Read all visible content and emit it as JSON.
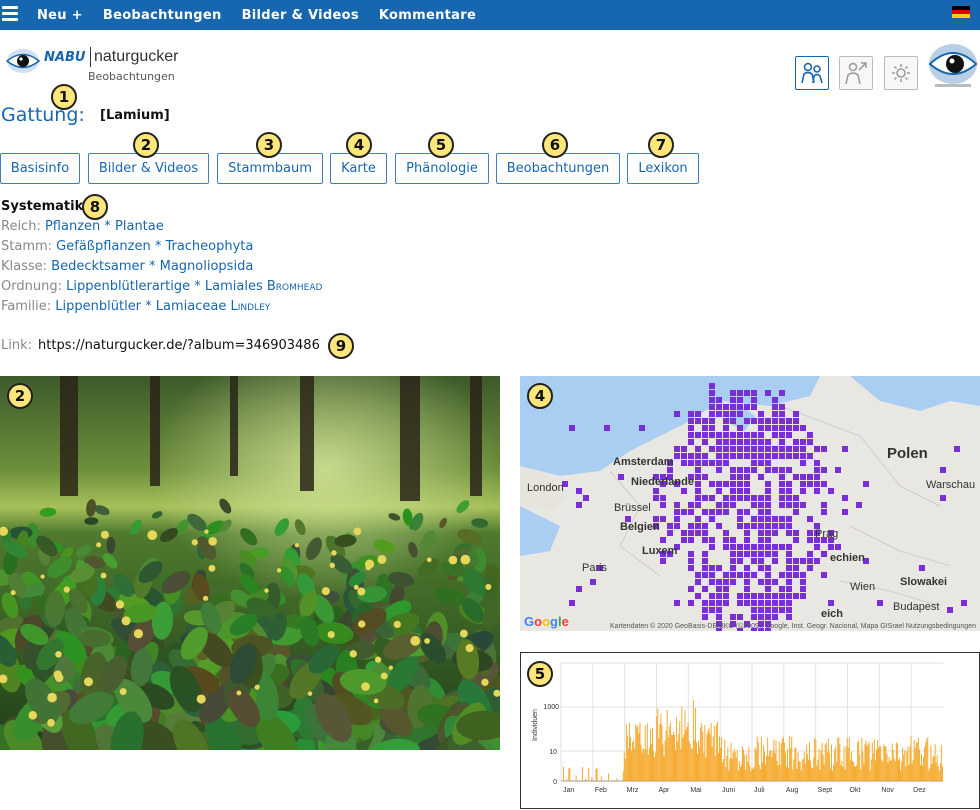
{
  "topbar": {
    "nav": [
      "Neu +",
      "Beobachtungen",
      "Bilder & Videos",
      "Kommentare"
    ]
  },
  "logo": {
    "brand": "NABU",
    "brand2": "naturgucker",
    "sub": "Beobachtungen"
  },
  "title": {
    "label": "Gattung:",
    "genus": "[Lamium]"
  },
  "tabs": [
    "Basisinfo",
    "Bilder & Videos",
    "Stammbaum",
    "Karte",
    "Phänologie",
    "Beobachtungen",
    "Lexikon"
  ],
  "systematik": {
    "heading": "Systematik",
    "rows": [
      {
        "label": "Reich:",
        "value": "Pflanzen * Plantae",
        "author": ""
      },
      {
        "label": "Stamm:",
        "value": "Gefäßpflanzen * Tracheophyta",
        "author": ""
      },
      {
        "label": "Klasse:",
        "value": "Bedecktsamer * Magnoliopsida",
        "author": ""
      },
      {
        "label": "Ordnung:",
        "value": "Lippenblütlerartige * Lamiales",
        "author": "Bromhead"
      },
      {
        "label": "Familie:",
        "value": "Lippenblütler * Lamiaceae",
        "author": "Lindley"
      }
    ]
  },
  "link": {
    "label": "Link:",
    "url": "https://naturgucker.de/?album=346903486"
  },
  "map": {
    "labels": [
      "Amsterdam",
      "Niederlande",
      "London",
      "Brüssel",
      "Belgien",
      "Luxem",
      "Paris",
      "Polen",
      "Warschau",
      "Prag",
      "echien",
      "Slowakei",
      "Wien",
      "Budapest",
      "eich"
    ],
    "watermark": "Google",
    "attribution": "Kartendaten © 2020 GeoBasis-DE/BKG (©2009), Google, Inst. Geogr. Nacional, Mapa GISrael  Nutzungsbedingungen"
  },
  "phenology": {
    "ylabel": "Individuen",
    "yticks": [
      "0",
      "10",
      "1000"
    ],
    "months": [
      "Jan",
      "Feb",
      "Mrz",
      "Apr",
      "Mai",
      "Juni",
      "Juli",
      "Aug",
      "Sept",
      "Okt",
      "Nov",
      "Dez"
    ],
    "color": "#f5a623"
  },
  "markers": [
    "1",
    "2",
    "3",
    "4",
    "5",
    "6",
    "7",
    "8",
    "9",
    "2",
    "4",
    "5"
  ],
  "colors": {
    "topbar": "#1766b0",
    "link": "#1766b0",
    "map_dots": "#7a2fd6",
    "marker": "#fde77a"
  }
}
